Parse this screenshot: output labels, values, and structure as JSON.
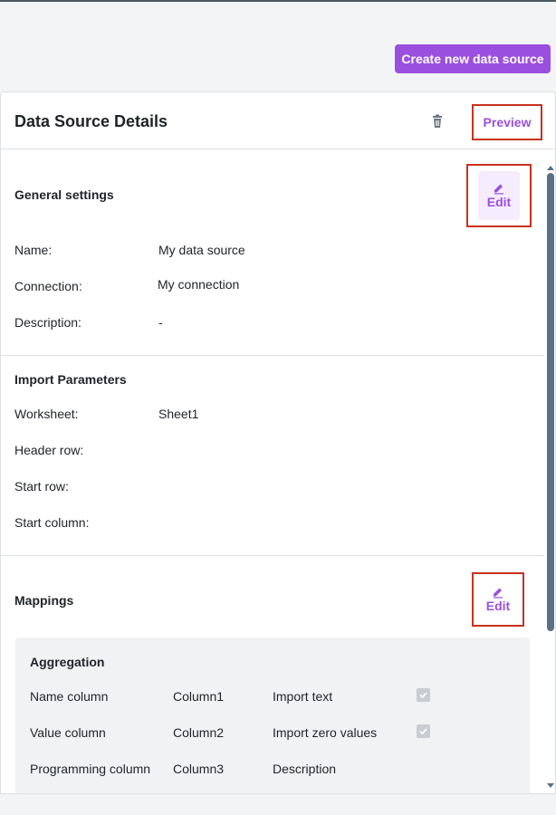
{
  "toolbar": {
    "create_label": "Create new data source"
  },
  "panel": {
    "title": "Data Source Details",
    "preview_label": "Preview",
    "delete_icon": "trash-icon"
  },
  "general": {
    "title": "General settings",
    "edit_label": "Edit",
    "fields": [
      {
        "label": "Name:",
        "value": "My data source"
      },
      {
        "label": "Connection:",
        "value": "My connection"
      },
      {
        "label": "Description:",
        "value": "-"
      }
    ]
  },
  "import": {
    "title": "Import Parameters",
    "fields": [
      {
        "label": "Worksheet:",
        "value": "Sheet1"
      },
      {
        "label": "Header row:",
        "value": ""
      },
      {
        "label": "Start row:",
        "value": ""
      },
      {
        "label": "Start column:",
        "value": ""
      }
    ]
  },
  "mappings": {
    "title": "Mappings",
    "edit_label": "Edit",
    "aggregation": {
      "title": "Aggregation",
      "rows": [
        {
          "label": "Name column",
          "value": "Column1",
          "option": "Import text",
          "checked": true
        },
        {
          "label": "Value column",
          "value": "Column2",
          "option": "Import zero values",
          "checked": true
        },
        {
          "label": "Programming column",
          "value": "Column3",
          "option": "Description"
        }
      ]
    }
  },
  "colors": {
    "accent": "#9b4fdf",
    "highlight": "#c8321e",
    "scrollbar": "#5a7183"
  }
}
